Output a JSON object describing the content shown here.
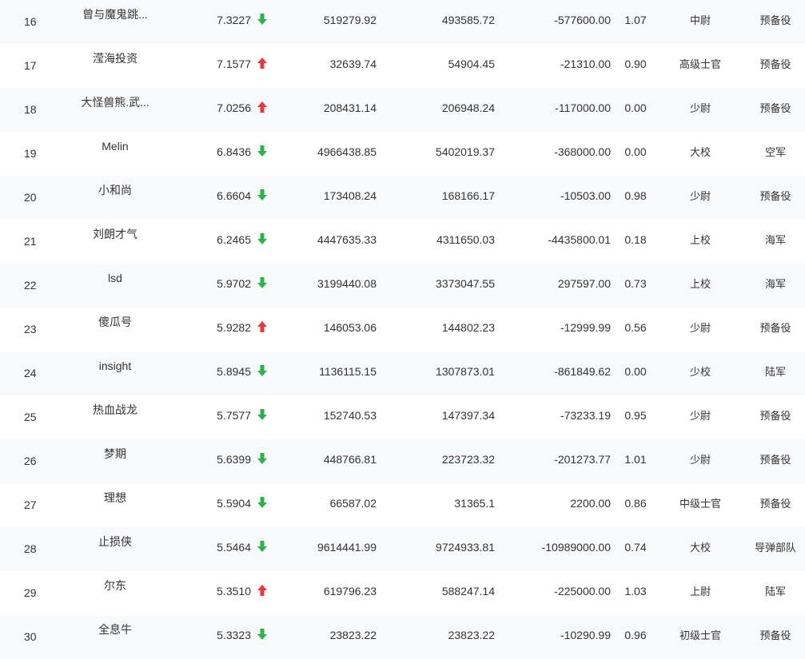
{
  "colors": {
    "up": "#e8383d",
    "down": "#2cb24a",
    "text": "#333333",
    "row_alt": "#f8f9fb"
  },
  "rows": [
    {
      "rank": "16",
      "name": "曾与魔鬼跳...",
      "score": "7.3227",
      "trend": "down",
      "v1": "519279.92",
      "v2": "493585.72",
      "v3": "-577600.00",
      "ratio": "1.07",
      "title": "中尉",
      "branch": "预备役"
    },
    {
      "rank": "17",
      "name": "滢海投资",
      "score": "7.1577",
      "trend": "up",
      "v1": "32639.74",
      "v2": "54904.45",
      "v3": "-21310.00",
      "ratio": "0.90",
      "title": "高级士官",
      "branch": "预备役"
    },
    {
      "rank": "18",
      "name": "大怪兽熊.武...",
      "score": "7.0256",
      "trend": "up",
      "v1": "208431.14",
      "v2": "206948.24",
      "v3": "-117000.00",
      "ratio": "0.00",
      "title": "少尉",
      "branch": "预备役"
    },
    {
      "rank": "19",
      "name": "Melin",
      "score": "6.8436",
      "trend": "down",
      "v1": "4966438.85",
      "v2": "5402019.37",
      "v3": "-368000.00",
      "ratio": "0.00",
      "title": "大校",
      "branch": "空军"
    },
    {
      "rank": "20",
      "name": "小和尚",
      "score": "6.6604",
      "trend": "down",
      "v1": "173408.24",
      "v2": "168166.17",
      "v3": "-10503.00",
      "ratio": "0.98",
      "title": "少尉",
      "branch": "预备役"
    },
    {
      "rank": "21",
      "name": "刘朗才气",
      "score": "6.2465",
      "trend": "down",
      "v1": "4447635.33",
      "v2": "4311650.03",
      "v3": "-4435800.01",
      "ratio": "0.18",
      "title": "上校",
      "branch": "海军"
    },
    {
      "rank": "22",
      "name": "lsd",
      "score": "5.9702",
      "trend": "down",
      "v1": "3199440.08",
      "v2": "3373047.55",
      "v3": "297597.00",
      "ratio": "0.73",
      "title": "上校",
      "branch": "海军"
    },
    {
      "rank": "23",
      "name": "傻瓜号",
      "score": "5.9282",
      "trend": "up",
      "v1": "146053.06",
      "v2": "144802.23",
      "v3": "-12999.99",
      "ratio": "0.56",
      "title": "少尉",
      "branch": "预备役"
    },
    {
      "rank": "24",
      "name": "insight",
      "score": "5.8945",
      "trend": "down",
      "v1": "1136115.15",
      "v2": "1307873.01",
      "v3": "-861849.62",
      "ratio": "0.00",
      "title": "少校",
      "branch": "陆军"
    },
    {
      "rank": "25",
      "name": "热血战龙",
      "score": "5.7577",
      "trend": "down",
      "v1": "152740.53",
      "v2": "147397.34",
      "v3": "-73233.19",
      "ratio": "0.95",
      "title": "少尉",
      "branch": "预备役"
    },
    {
      "rank": "26",
      "name": "梦期",
      "score": "5.6399",
      "trend": "down",
      "v1": "448766.81",
      "v2": "223723.32",
      "v3": "-201273.77",
      "ratio": "1.01",
      "title": "少尉",
      "branch": "预备役"
    },
    {
      "rank": "27",
      "name": "理想",
      "score": "5.5904",
      "trend": "down",
      "v1": "66587.02",
      "v2": "31365.1",
      "v3": "2200.00",
      "ratio": "0.86",
      "title": "中级士官",
      "branch": "预备役"
    },
    {
      "rank": "28",
      "name": "止损侠",
      "score": "5.5464",
      "trend": "down",
      "v1": "9614441.99",
      "v2": "9724933.81",
      "v3": "-10989000.00",
      "ratio": "0.74",
      "title": "大校",
      "branch": "导弹部队"
    },
    {
      "rank": "29",
      "name": "尔东",
      "score": "5.3510",
      "trend": "up",
      "v1": "619796.23",
      "v2": "588247.14",
      "v3": "-225000.00",
      "ratio": "1.03",
      "title": "上尉",
      "branch": "陆军"
    },
    {
      "rank": "30",
      "name": "全息牛",
      "score": "5.3323",
      "trend": "down",
      "v1": "23823.22",
      "v2": "23823.22",
      "v3": "-10290.99",
      "ratio": "0.96",
      "title": "初级士官",
      "branch": "预备役"
    }
  ]
}
